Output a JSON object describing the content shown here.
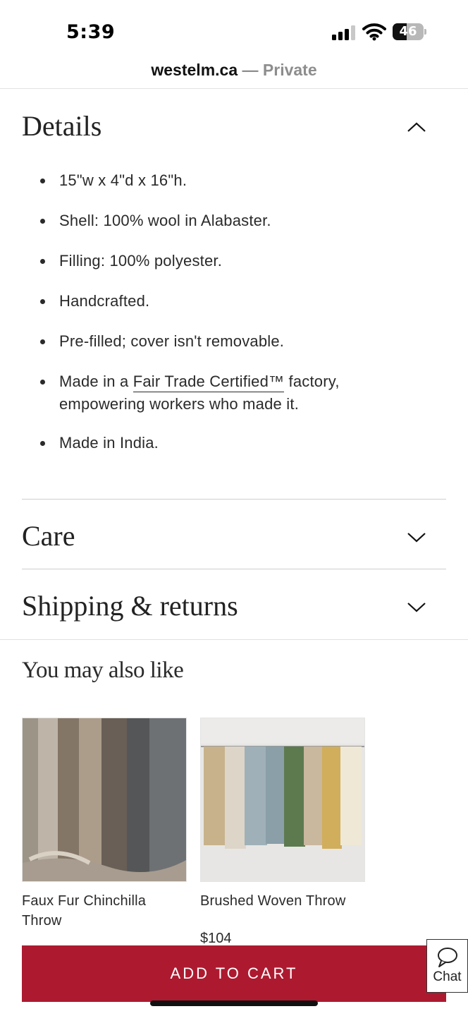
{
  "status_bar": {
    "time": "5:39",
    "battery": "46",
    "battery_level": 0.46,
    "signal_bars_active": 3,
    "signal_bars_total": 4
  },
  "browser": {
    "domain": "westelm.ca",
    "separator": "—",
    "mode": "Private"
  },
  "details": {
    "title": "Details",
    "expanded": true,
    "items": [
      "15\"w x 4\"d x 16\"h.",
      "Shell: 100% wool in Alabaster.",
      "Filling: 100% polyester.",
      "Handcrafted.",
      "Pre-filled; cover isn't removable."
    ],
    "fair_trade": {
      "prefix": "Made in a ",
      "link": "Fair Trade Certified™",
      "suffix": " factory, empowering workers who made it."
    },
    "last_item": "Made in India."
  },
  "care": {
    "title": "Care",
    "expanded": false
  },
  "shipping": {
    "title": "Shipping & returns",
    "expanded": false
  },
  "recommendations": {
    "title": "You may also like",
    "products": [
      {
        "name": "Faux Fur Chinchilla Throw",
        "price": ""
      },
      {
        "name": "Brushed Woven Throw",
        "price": "$104"
      }
    ]
  },
  "actions": {
    "add_to_cart": "ADD TO CART",
    "chat": "Chat"
  },
  "colors": {
    "accent": "#ad1a30",
    "text": "#222222",
    "divider": "#cfcfcf"
  },
  "icons": {
    "collapse": "chevron-up-icon",
    "expand": "chevron-down-icon",
    "chat": "speech-bubble-icon"
  }
}
